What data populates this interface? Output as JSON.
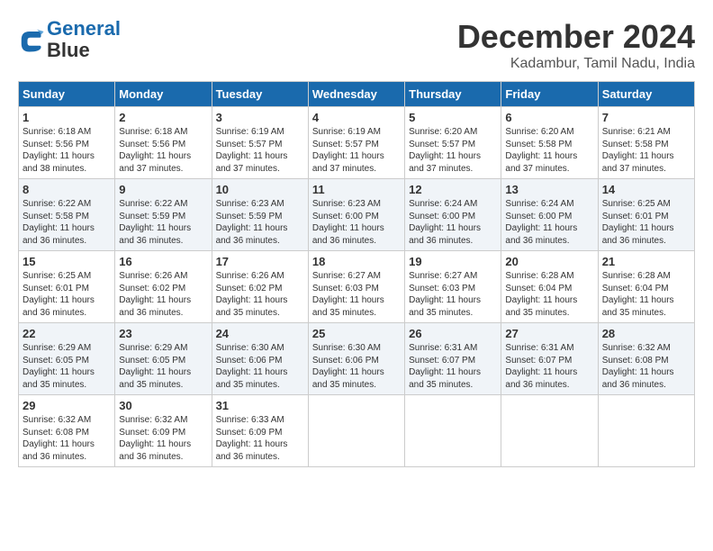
{
  "logo": {
    "line1": "General",
    "line2": "Blue"
  },
  "title": "December 2024",
  "location": "Kadambur, Tamil Nadu, India",
  "days_of_week": [
    "Sunday",
    "Monday",
    "Tuesday",
    "Wednesday",
    "Thursday",
    "Friday",
    "Saturday"
  ],
  "weeks": [
    [
      {
        "day": "1",
        "sunrise": "Sunrise: 6:18 AM",
        "sunset": "Sunset: 5:56 PM",
        "daylight": "Daylight: 11 hours and 38 minutes."
      },
      {
        "day": "2",
        "sunrise": "Sunrise: 6:18 AM",
        "sunset": "Sunset: 5:56 PM",
        "daylight": "Daylight: 11 hours and 37 minutes."
      },
      {
        "day": "3",
        "sunrise": "Sunrise: 6:19 AM",
        "sunset": "Sunset: 5:57 PM",
        "daylight": "Daylight: 11 hours and 37 minutes."
      },
      {
        "day": "4",
        "sunrise": "Sunrise: 6:19 AM",
        "sunset": "Sunset: 5:57 PM",
        "daylight": "Daylight: 11 hours and 37 minutes."
      },
      {
        "day": "5",
        "sunrise": "Sunrise: 6:20 AM",
        "sunset": "Sunset: 5:57 PM",
        "daylight": "Daylight: 11 hours and 37 minutes."
      },
      {
        "day": "6",
        "sunrise": "Sunrise: 6:20 AM",
        "sunset": "Sunset: 5:58 PM",
        "daylight": "Daylight: 11 hours and 37 minutes."
      },
      {
        "day": "7",
        "sunrise": "Sunrise: 6:21 AM",
        "sunset": "Sunset: 5:58 PM",
        "daylight": "Daylight: 11 hours and 37 minutes."
      }
    ],
    [
      {
        "day": "8",
        "sunrise": "Sunrise: 6:22 AM",
        "sunset": "Sunset: 5:58 PM",
        "daylight": "Daylight: 11 hours and 36 minutes."
      },
      {
        "day": "9",
        "sunrise": "Sunrise: 6:22 AM",
        "sunset": "Sunset: 5:59 PM",
        "daylight": "Daylight: 11 hours and 36 minutes."
      },
      {
        "day": "10",
        "sunrise": "Sunrise: 6:23 AM",
        "sunset": "Sunset: 5:59 PM",
        "daylight": "Daylight: 11 hours and 36 minutes."
      },
      {
        "day": "11",
        "sunrise": "Sunrise: 6:23 AM",
        "sunset": "Sunset: 6:00 PM",
        "daylight": "Daylight: 11 hours and 36 minutes."
      },
      {
        "day": "12",
        "sunrise": "Sunrise: 6:24 AM",
        "sunset": "Sunset: 6:00 PM",
        "daylight": "Daylight: 11 hours and 36 minutes."
      },
      {
        "day": "13",
        "sunrise": "Sunrise: 6:24 AM",
        "sunset": "Sunset: 6:00 PM",
        "daylight": "Daylight: 11 hours and 36 minutes."
      },
      {
        "day": "14",
        "sunrise": "Sunrise: 6:25 AM",
        "sunset": "Sunset: 6:01 PM",
        "daylight": "Daylight: 11 hours and 36 minutes."
      }
    ],
    [
      {
        "day": "15",
        "sunrise": "Sunrise: 6:25 AM",
        "sunset": "Sunset: 6:01 PM",
        "daylight": "Daylight: 11 hours and 36 minutes."
      },
      {
        "day": "16",
        "sunrise": "Sunrise: 6:26 AM",
        "sunset": "Sunset: 6:02 PM",
        "daylight": "Daylight: 11 hours and 36 minutes."
      },
      {
        "day": "17",
        "sunrise": "Sunrise: 6:26 AM",
        "sunset": "Sunset: 6:02 PM",
        "daylight": "Daylight: 11 hours and 35 minutes."
      },
      {
        "day": "18",
        "sunrise": "Sunrise: 6:27 AM",
        "sunset": "Sunset: 6:03 PM",
        "daylight": "Daylight: 11 hours and 35 minutes."
      },
      {
        "day": "19",
        "sunrise": "Sunrise: 6:27 AM",
        "sunset": "Sunset: 6:03 PM",
        "daylight": "Daylight: 11 hours and 35 minutes."
      },
      {
        "day": "20",
        "sunrise": "Sunrise: 6:28 AM",
        "sunset": "Sunset: 6:04 PM",
        "daylight": "Daylight: 11 hours and 35 minutes."
      },
      {
        "day": "21",
        "sunrise": "Sunrise: 6:28 AM",
        "sunset": "Sunset: 6:04 PM",
        "daylight": "Daylight: 11 hours and 35 minutes."
      }
    ],
    [
      {
        "day": "22",
        "sunrise": "Sunrise: 6:29 AM",
        "sunset": "Sunset: 6:05 PM",
        "daylight": "Daylight: 11 hours and 35 minutes."
      },
      {
        "day": "23",
        "sunrise": "Sunrise: 6:29 AM",
        "sunset": "Sunset: 6:05 PM",
        "daylight": "Daylight: 11 hours and 35 minutes."
      },
      {
        "day": "24",
        "sunrise": "Sunrise: 6:30 AM",
        "sunset": "Sunset: 6:06 PM",
        "daylight": "Daylight: 11 hours and 35 minutes."
      },
      {
        "day": "25",
        "sunrise": "Sunrise: 6:30 AM",
        "sunset": "Sunset: 6:06 PM",
        "daylight": "Daylight: 11 hours and 35 minutes."
      },
      {
        "day": "26",
        "sunrise": "Sunrise: 6:31 AM",
        "sunset": "Sunset: 6:07 PM",
        "daylight": "Daylight: 11 hours and 35 minutes."
      },
      {
        "day": "27",
        "sunrise": "Sunrise: 6:31 AM",
        "sunset": "Sunset: 6:07 PM",
        "daylight": "Daylight: 11 hours and 36 minutes."
      },
      {
        "day": "28",
        "sunrise": "Sunrise: 6:32 AM",
        "sunset": "Sunset: 6:08 PM",
        "daylight": "Daylight: 11 hours and 36 minutes."
      }
    ],
    [
      {
        "day": "29",
        "sunrise": "Sunrise: 6:32 AM",
        "sunset": "Sunset: 6:08 PM",
        "daylight": "Daylight: 11 hours and 36 minutes."
      },
      {
        "day": "30",
        "sunrise": "Sunrise: 6:32 AM",
        "sunset": "Sunset: 6:09 PM",
        "daylight": "Daylight: 11 hours and 36 minutes."
      },
      {
        "day": "31",
        "sunrise": "Sunrise: 6:33 AM",
        "sunset": "Sunset: 6:09 PM",
        "daylight": "Daylight: 11 hours and 36 minutes."
      },
      null,
      null,
      null,
      null
    ]
  ]
}
